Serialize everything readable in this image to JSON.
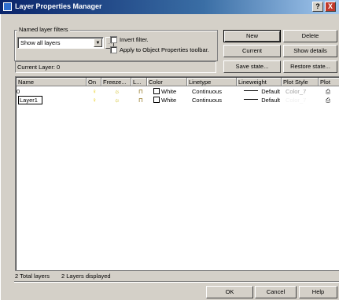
{
  "window": {
    "title": "Layer Properties Manager",
    "help_glyph": "?",
    "close_glyph": "X"
  },
  "filters": {
    "group_label": "Named layer filters",
    "selected": "Show all layers",
    "ellipsis": "...",
    "invert_label": "Invert filter.",
    "apply_label": "Apply to Object Properties toolbar."
  },
  "buttons": {
    "new": "New",
    "delete": "Delete",
    "current": "Current",
    "show_details": "Show details",
    "save_state": "Save state...",
    "restore_state": "Restore state...",
    "ok": "OK",
    "cancel": "Cancel",
    "help": "Help"
  },
  "current_layer": "Current Layer:  0",
  "table": {
    "headers": [
      "Name",
      "On",
      "Freeze...",
      "L...",
      "Color",
      "Linetype",
      "Lineweight",
      "Plot Style",
      "Plot"
    ],
    "rows": [
      {
        "name": "0",
        "color": "White",
        "linetype": "Continuous",
        "lineweight": "Default",
        "plot_style": "Color_7"
      },
      {
        "name": "Layer1",
        "color": "White",
        "linetype": "Continuous",
        "lineweight": "Default",
        "plot_style": "Color_7"
      }
    ]
  },
  "status": {
    "total": "2 Total layers",
    "displayed": "2 Layers displayed"
  },
  "colors": {
    "title_start": "#0a246a",
    "title_end": "#a6caf0",
    "face": "#d4d0c8",
    "selection": "#0a246a"
  }
}
